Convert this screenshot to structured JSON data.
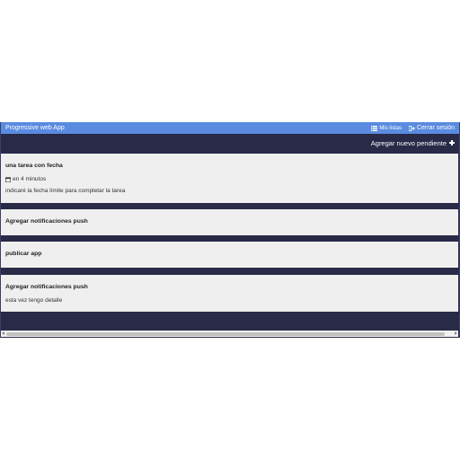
{
  "navbar": {
    "brand": "Progressive web App",
    "my_lists_label": "Mis listas",
    "my_lists_icon": "list-icon",
    "logout_label": "Cerrar sesión",
    "logout_icon": "sign-out-icon"
  },
  "toolbar": {
    "add_label": "Agregar nuevo pendiente",
    "add_icon": "plus-icon"
  },
  "tasks": [
    {
      "title": "una tarea con fecha",
      "due_icon": "calendar-icon",
      "due": "en 4 minutos",
      "detail": "indicaré la fecha límite para completar la tarea"
    },
    {
      "title": "Agregar notificaciones push"
    },
    {
      "title": "publicar app"
    },
    {
      "title": "Agregar notificaciones push",
      "detail": "esta vez tengo detalle"
    }
  ],
  "colors": {
    "navbar": "#5a8be0",
    "background": "#282a47",
    "card": "#efefef"
  }
}
